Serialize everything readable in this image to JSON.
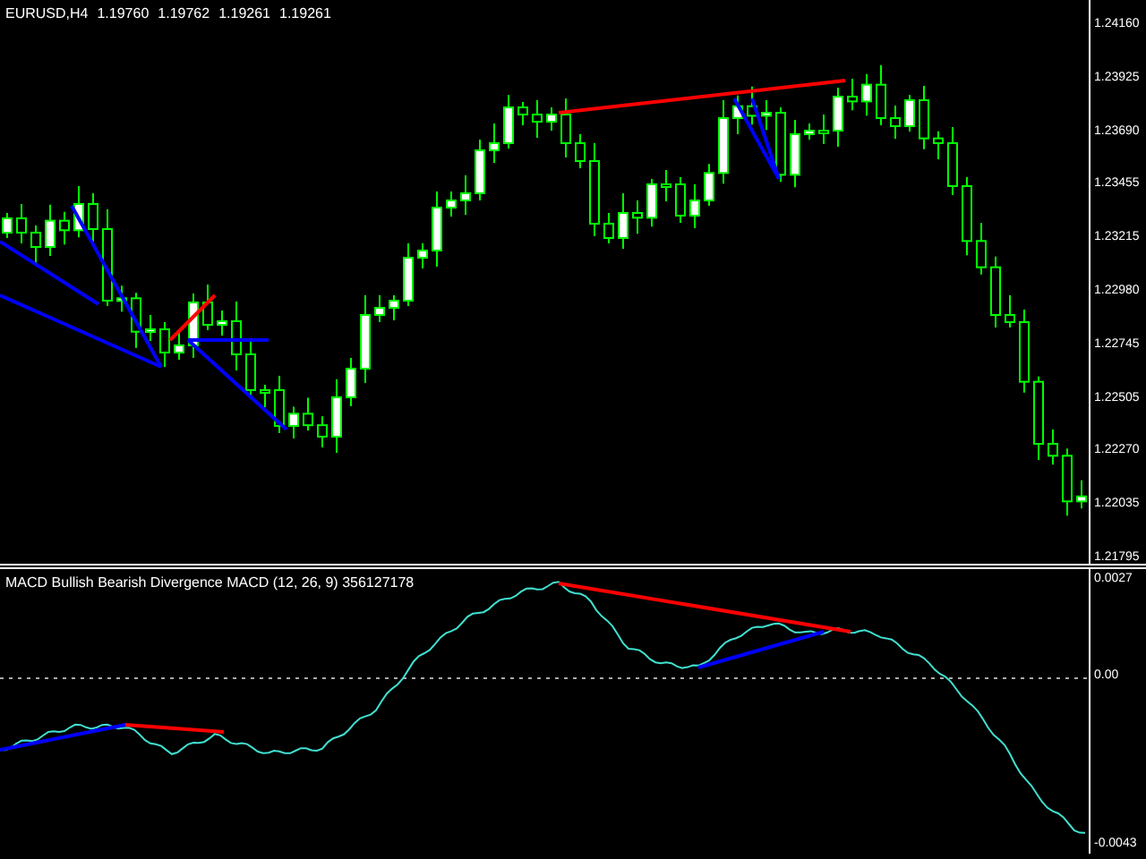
{
  "price_pane": {
    "symbol": "EURUSD,H4",
    "quotes": [
      "1.19760",
      "1.19762",
      "1.19261",
      "1.19261"
    ],
    "axis_labels": [
      "1.24160",
      "1.23925",
      "1.23690",
      "1.23455",
      "1.23215",
      "1.22980",
      "1.22745",
      "1.22505",
      "1.22270",
      "1.22035",
      "1.21795"
    ]
  },
  "indicator_pane": {
    "title": "MACD Bullish Bearish Divergence MACD (12, 26, 9) 356127178",
    "axis_labels": [
      "0.0027",
      "0.00",
      "-0.0043"
    ]
  }
}
